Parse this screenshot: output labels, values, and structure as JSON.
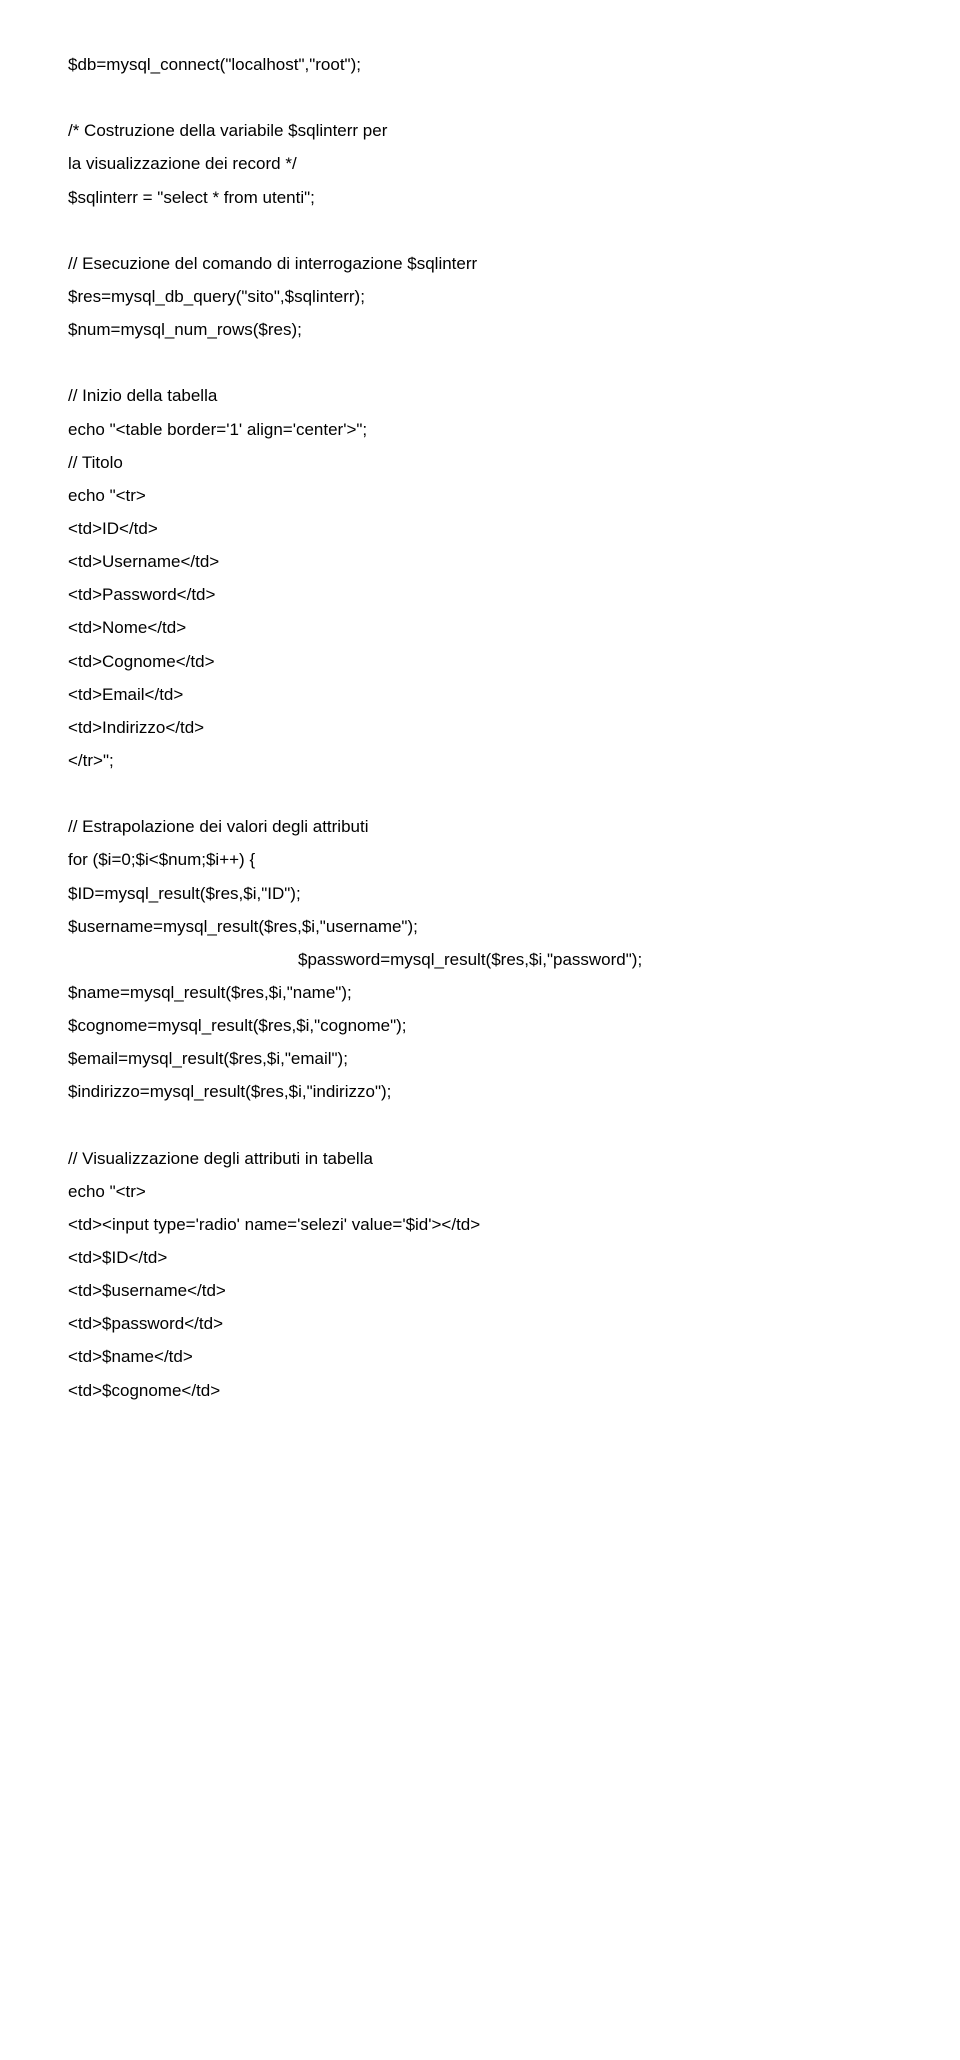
{
  "lines": [
    {
      "text": "$db=mysql_connect(\"localhost\",\"root\");",
      "cls": "line"
    },
    {
      "text": "",
      "cls": "blank"
    },
    {
      "text": "/* Costruzione della variabile $sqlinterr per",
      "cls": "line"
    },
    {
      "text": "la visualizzazione dei record */",
      "cls": "line"
    },
    {
      "text": "$sqlinterr = \"select * from utenti\";",
      "cls": "line"
    },
    {
      "text": "",
      "cls": "blank"
    },
    {
      "text": "// Esecuzione del comando di interrogazione $sqlinterr",
      "cls": "line"
    },
    {
      "text": "$res=mysql_db_query(\"sito\",$sqlinterr);",
      "cls": "line"
    },
    {
      "text": "$num=mysql_num_rows($res);",
      "cls": "line"
    },
    {
      "text": "",
      "cls": "blank"
    },
    {
      "text": "// Inizio della tabella",
      "cls": "line"
    },
    {
      "text": "echo \"<table border='1' align='center'>\";",
      "cls": "line"
    },
    {
      "text": "// Titolo",
      "cls": "line"
    },
    {
      "text": "echo \"<tr>",
      "cls": "line"
    },
    {
      "text": "<td>ID</td>",
      "cls": "line"
    },
    {
      "text": "<td>Username</td>",
      "cls": "line"
    },
    {
      "text": "<td>Password</td>",
      "cls": "line"
    },
    {
      "text": "<td>Nome</td>",
      "cls": "line"
    },
    {
      "text": "<td>Cognome</td>",
      "cls": "line"
    },
    {
      "text": "<td>Email</td>",
      "cls": "line"
    },
    {
      "text": "<td>Indirizzo</td>",
      "cls": "line"
    },
    {
      "text": "</tr>\";",
      "cls": "line"
    },
    {
      "text": "",
      "cls": "blank"
    },
    {
      "text": "// Estrapolazione dei valori degli attributi",
      "cls": "line"
    },
    {
      "text": "for ($i=0;$i<$num;$i++) {",
      "cls": "line"
    },
    {
      "text": "$ID=mysql_result($res,$i,\"ID\");",
      "cls": "line"
    },
    {
      "text": "$username=mysql_result($res,$i,\"username\");",
      "cls": "line"
    },
    {
      "text": "$password=mysql_result($res,$i,\"password\");",
      "cls": "line indent"
    },
    {
      "text": "$name=mysql_result($res,$i,\"name\");",
      "cls": "line"
    },
    {
      "text": "$cognome=mysql_result($res,$i,\"cognome\");",
      "cls": "line"
    },
    {
      "text": "$email=mysql_result($res,$i,\"email\");",
      "cls": "line"
    },
    {
      "text": "$indirizzo=mysql_result($res,$i,\"indirizzo\");",
      "cls": "line"
    },
    {
      "text": "",
      "cls": "blank"
    },
    {
      "text": "// Visualizzazione degli attributi in tabella",
      "cls": "line"
    },
    {
      "text": "echo \"<tr>",
      "cls": "line"
    },
    {
      "text": "<td><input type='radio' name='selezi' value='$id'></td>",
      "cls": "line"
    },
    {
      "text": "<td>$ID</td>",
      "cls": "line"
    },
    {
      "text": "<td>$username</td>",
      "cls": "line"
    },
    {
      "text": "<td>$password</td>",
      "cls": "line"
    },
    {
      "text": "<td>$name</td>",
      "cls": "line"
    },
    {
      "text": "<td>$cognome</td>",
      "cls": "line"
    }
  ]
}
